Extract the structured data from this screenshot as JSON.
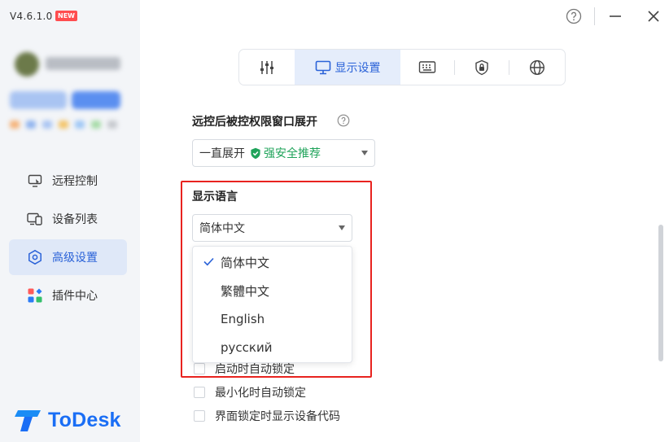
{
  "sidebar": {
    "version": "V4.6.1.0",
    "new_badge": "NEW",
    "nav": [
      {
        "label": "远程控制",
        "icon": "remote-control-icon",
        "active": false
      },
      {
        "label": "设备列表",
        "icon": "device-list-icon",
        "active": false
      },
      {
        "label": "高级设置",
        "icon": "settings-hexagon-icon",
        "active": true
      },
      {
        "label": "插件中心",
        "icon": "plugin-center-icon",
        "active": false
      }
    ],
    "logo_text": "ToDesk"
  },
  "tabs": [
    {
      "icon": "sliders-icon",
      "label": ""
    },
    {
      "icon": "monitor-icon",
      "label": "显示设置",
      "active": true
    },
    {
      "icon": "keyboard-icon",
      "label": ""
    },
    {
      "icon": "lock-shield-icon",
      "label": ""
    },
    {
      "icon": "globe-icon",
      "label": ""
    }
  ],
  "content": {
    "window_expand_label": "远控后被控权限窗口展开",
    "window_expand_value": "一直展开",
    "window_expand_badge": "强安全推荐",
    "language_label": "显示语言",
    "language_value": "简体中文",
    "language_options": [
      "简体中文",
      "繁體中文",
      "English",
      "русский"
    ],
    "language_selected_index": 0,
    "checkboxes": [
      {
        "label": "启动时自动锁定",
        "checked": false
      },
      {
        "label": "最小化时自动锁定",
        "checked": false
      },
      {
        "label": "界面锁定时显示设备代码",
        "checked": false
      }
    ]
  },
  "colors": {
    "accent": "#2a62d8",
    "secure_green": "#1fa35a",
    "highlight_red": "#e8231f",
    "logo_blue": "#1a6ef5"
  }
}
